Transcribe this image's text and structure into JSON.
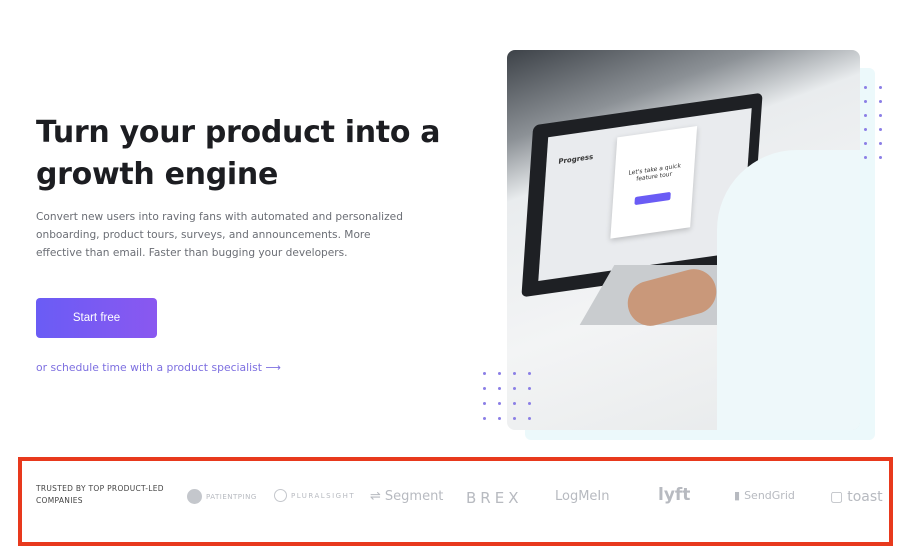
{
  "hero": {
    "title": "Turn your product into a growth engine",
    "description": "Convert new users into raving fans with automated and personalized onboarding, product tours, surveys, and announcements. More effective than email. Faster than bugging your developers.",
    "cta_label": "Start free",
    "secondary_link": "or schedule time with a product specialist ⟶"
  },
  "screen": {
    "progress_title": "Progress",
    "modal_title": "Let's take a quick feature tour"
  },
  "trusted": {
    "label": "TRUSTED BY TOP PRODUCT-LED COMPANIES",
    "logos": [
      "PATIENTPING",
      "PLURALSIGHT",
      "Segment",
      "BREX",
      "LogMeIn",
      "lyft",
      "SendGrid",
      "toast"
    ]
  },
  "colors": {
    "accent": "#6a5cf5",
    "highlight_border": "#e8391d"
  }
}
